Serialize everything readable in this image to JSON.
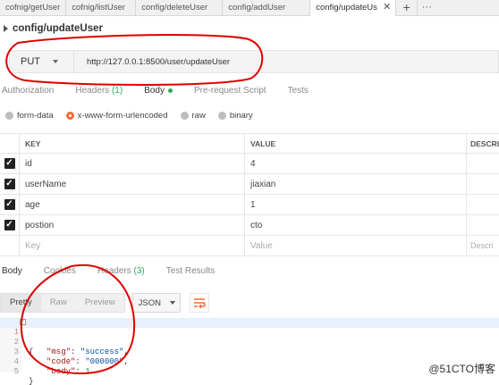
{
  "tabs": [
    {
      "label": "cofnig/getUser"
    },
    {
      "label": "cofnig/listUser"
    },
    {
      "label": "config/deleteUser"
    },
    {
      "label": "config/addUser"
    },
    {
      "label": "config/updateUs",
      "active": true
    }
  ],
  "request": {
    "name": "config/updateUser",
    "method": "PUT",
    "url": "http://127.0.0.1:8500/user/updateUser"
  },
  "request_tabs": {
    "authorization": "Authorization",
    "headers": "Headers",
    "headers_count": "(1)",
    "body": "Body",
    "prerequest": "Pre-request Script",
    "tests": "Tests"
  },
  "body_types": {
    "form_data": "form-data",
    "urlencoded": "x-www-form-urlencoded",
    "raw": "raw",
    "binary": "binary",
    "selected": "x-www-form-urlencoded"
  },
  "params": {
    "headers": {
      "key": "KEY",
      "value": "VALUE",
      "description": "DESCRI"
    },
    "rows": [
      {
        "key": "id",
        "value": "4",
        "checked": true
      },
      {
        "key": "userName",
        "value": "jiaxian",
        "checked": true
      },
      {
        "key": "age",
        "value": "1",
        "checked": true
      },
      {
        "key": "postion",
        "value": "cto",
        "checked": true
      }
    ],
    "placeholder": {
      "key": "Key",
      "value": "Value",
      "description": "Descri"
    }
  },
  "response_tabs": {
    "body": "Body",
    "cookies": "Cookies",
    "headers": "Headers",
    "headers_count": "(3)",
    "test_results": "Test Results"
  },
  "response_toolbar": {
    "pretty": "Pretty",
    "raw": "Raw",
    "preview": "Preview",
    "format": "JSON"
  },
  "response_body": {
    "line_numbers": [
      "1",
      "2",
      "3",
      "4",
      "5"
    ],
    "open_brace": "{",
    "close_brace": "}",
    "msg_key": "\"msg\"",
    "msg_val": "\"success\"",
    "code_key": "\"code\"",
    "code_val": "\"000000\"",
    "body_key": "\"body\"",
    "body_val": "1"
  },
  "watermark": "@51CTO博客",
  "colors": {
    "accent": "#f26b3a",
    "green": "#27ae60",
    "annotation": "#e00000"
  }
}
